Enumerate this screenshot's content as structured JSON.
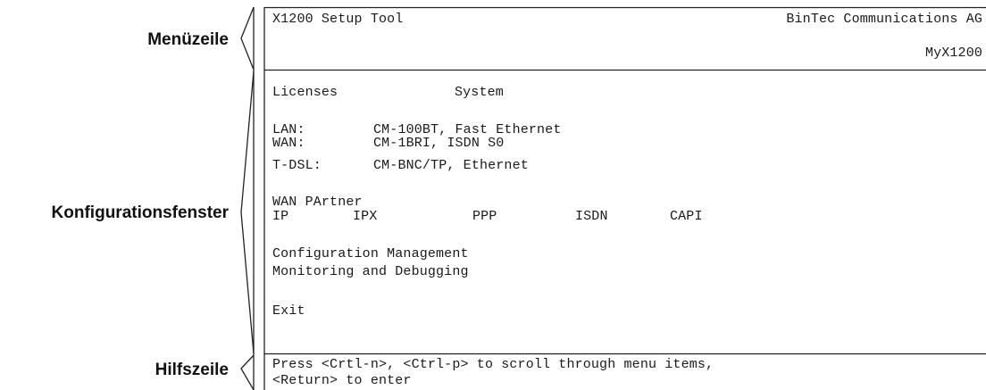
{
  "annotations": {
    "menu_bar": "Menüzeile",
    "config_window": "Konfigurationsfenster",
    "help_line": "Hilfszeile"
  },
  "header": {
    "title": "X1200 Setup Tool",
    "vendor": "BinTec Communications AG",
    "device": "MyX1200"
  },
  "menu": {
    "licenses": "Licenses",
    "system": "System",
    "interfaces": [
      {
        "label": "LAN:",
        "value": "CM-100BT, Fast Ethernet"
      },
      {
        "label": "WAN:",
        "value": "CM-1BRI, ISDN S0"
      },
      {
        "label": "T-DSL:",
        "value": "CM-BNC/TP, Ethernet"
      }
    ],
    "wan_partner": "WAN PArtner",
    "protocols": [
      "IP",
      "IPX",
      "PPP",
      "ISDN",
      "CAPI"
    ],
    "config_management": "Configuration Management",
    "monitoring": "Monitoring and Debugging",
    "exit": "Exit"
  },
  "help": {
    "line1": "Press <Crtl-n>, <Ctrl-p> to scroll through menu items,",
    "line2": "<Return> to enter"
  }
}
